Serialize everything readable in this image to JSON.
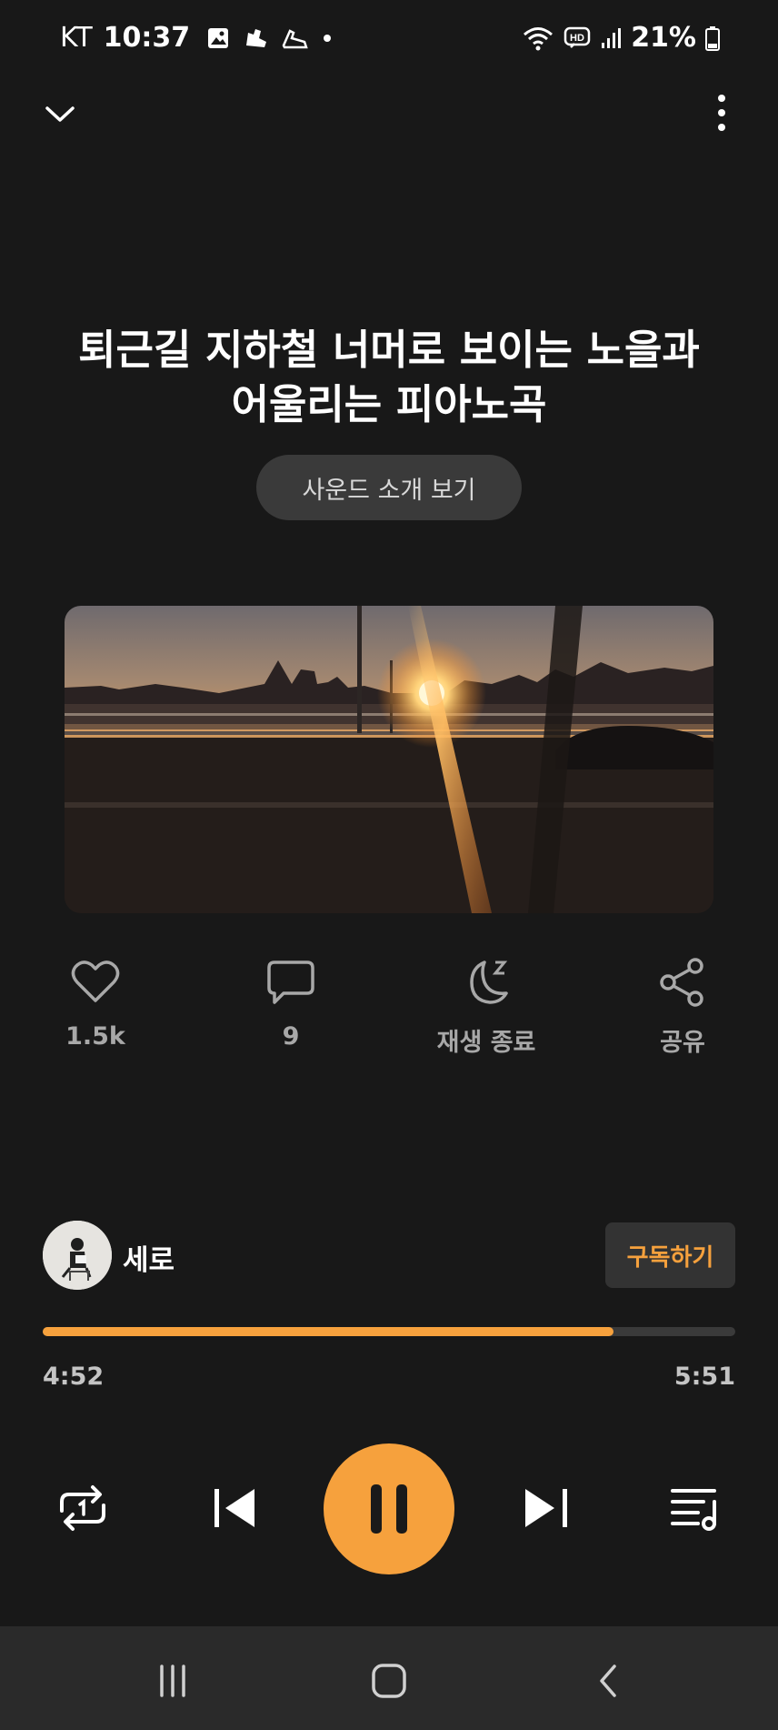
{
  "status_bar": {
    "carrier": "KT",
    "time": "10:37",
    "battery": "21%"
  },
  "track": {
    "title_line1": "퇴근길 지하철 너머로 보이는 노을과",
    "title_line2": "어울리는 피아노곡",
    "intro_button": "사운드 소개 보기"
  },
  "actions": {
    "likes": "1.5k",
    "comments": "9",
    "sleep_timer": "재생 종료",
    "share": "공유"
  },
  "artist": {
    "name": "세로",
    "subscribe_label": "구독하기"
  },
  "player": {
    "current_time": "4:52",
    "total_time": "5:51",
    "progress": 0.824
  },
  "colors": {
    "accent": "#f6a13d",
    "background": "#181818"
  }
}
